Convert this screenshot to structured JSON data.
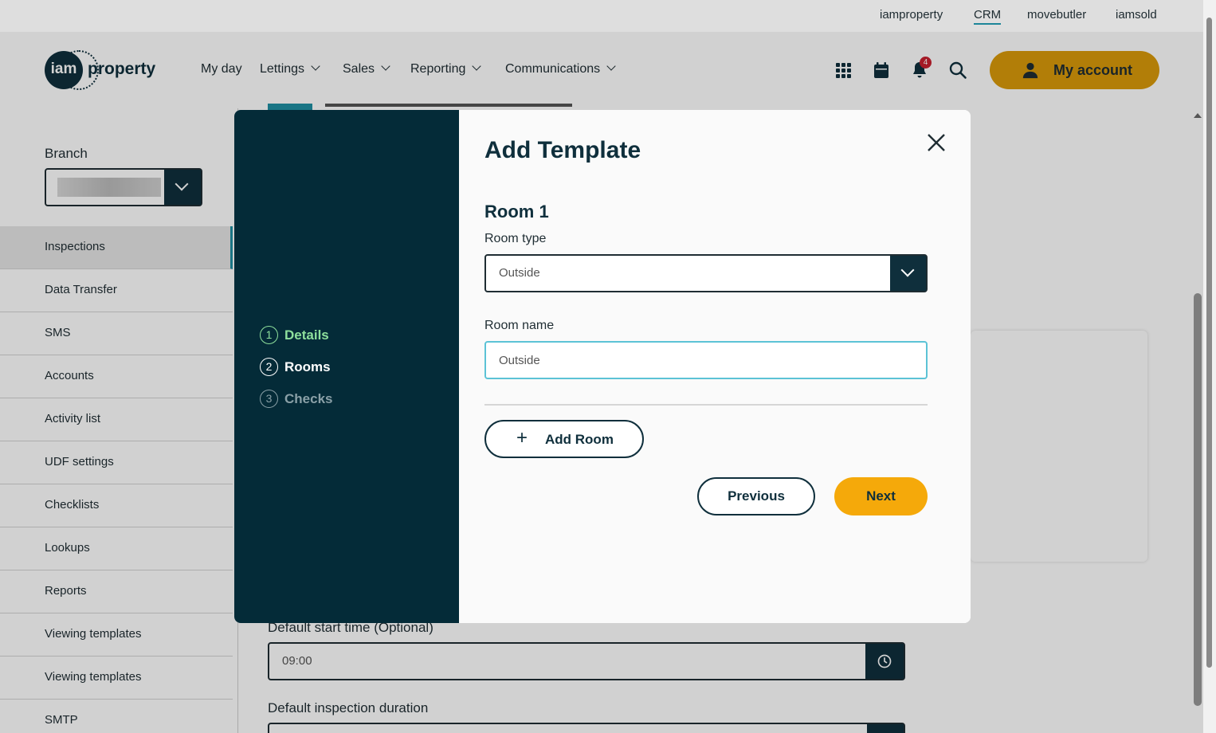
{
  "brand_links": [
    {
      "label": "iamproperty",
      "active": false
    },
    {
      "label": "CRM",
      "active": true
    },
    {
      "label": "movebutler",
      "active": false
    },
    {
      "label": "iamsold",
      "active": false
    }
  ],
  "header": {
    "logo_mark": "iam",
    "logo_text": "property",
    "nav": [
      "My day",
      "Lettings",
      "Sales",
      "Reporting",
      "Communications"
    ],
    "notification_count": "4",
    "account_label": "My account",
    "icons": [
      "apps-grid-icon",
      "calendar-icon",
      "bell-icon",
      "search-icon"
    ]
  },
  "sidebar": {
    "branch_label": "Branch",
    "items": [
      "Inspections",
      "Data Transfer",
      "SMS",
      "Accounts",
      "Activity list",
      "UDF settings",
      "Checklists",
      "Lookups",
      "Reports",
      "Viewing templates",
      "Viewing templates",
      "SMTP"
    ],
    "active_item": "Inspections"
  },
  "background": {
    "start_label": "Default start time (Optional)",
    "start_value": "09:00",
    "duration_label": "Default inspection duration"
  },
  "modal": {
    "title": "Add Template",
    "steps": [
      {
        "num": "1",
        "label": "Details",
        "state": "done"
      },
      {
        "num": "2",
        "label": "Rooms",
        "state": "current"
      },
      {
        "num": "3",
        "label": "Checks",
        "state": "todo"
      }
    ],
    "room_heading": "Room 1",
    "room_type_label": "Room type",
    "room_type_value": "Outside",
    "room_name_label": "Room name",
    "room_name_value": "Outside",
    "add_room_label": "Add Room",
    "previous_label": "Previous",
    "next_label": "Next"
  },
  "colors": {
    "dark_teal": "#042b38",
    "accent_yellow": "#f5a90a",
    "account_yellow": "#d99a0a",
    "step_done_green": "#8ee09c",
    "focus_blue": "#5cc3d6",
    "notification_red": "#c8202f"
  }
}
